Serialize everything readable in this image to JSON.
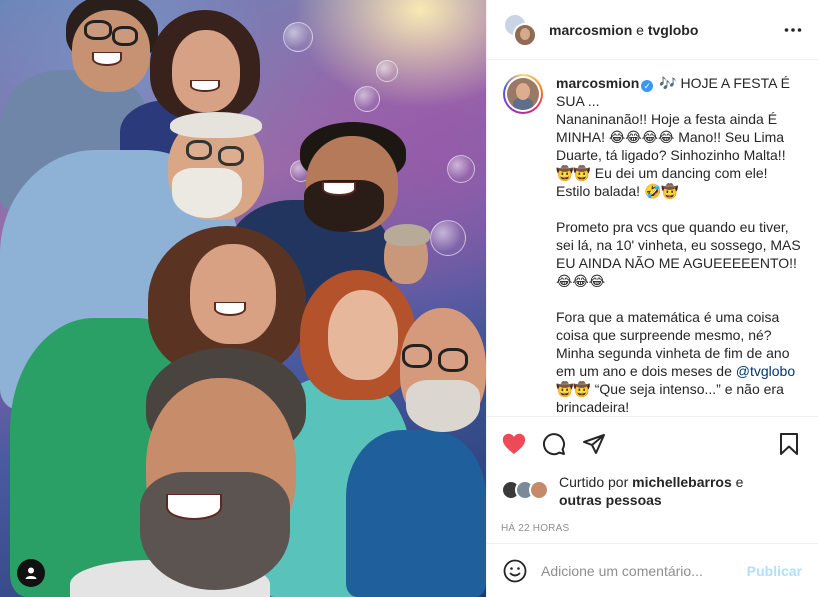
{
  "header": {
    "author": "marcosmion",
    "conjunction": "e",
    "collaborator": "tvglobo",
    "more_icon": "more-horizontal-icon"
  },
  "caption": {
    "username": "marcosmion",
    "verified_icon": "verified-badge-icon",
    "line1": " 🎶 HOJE A FESTA É SUA ...",
    "paragraph1": "Nananinanão!! Hoje a festa ainda É MINHA! 😂😂😂😂 Mano!! Seu Lima Duarte, tá ligado? Sinhozinho Malta!! 🤠🤠 Eu dei um dancing com ele! Estilo balada! 🤣🤠",
    "paragraph2": "Prometo pra vcs que quando eu tiver, sei lá, na 10' vinheta, eu sossego, MAS EU AINDA NÃO ME AGUEEEEENTO!! 😂😂😂",
    "paragraph3_a": "Fora que a matemática é uma coisa coisa que surpreende mesmo, né? Minha segunda vinheta de fim de ano em um ano e dois meses de ",
    "paragraph3_mention": "@tvglobo",
    "paragraph3_b": " 🤠🤠 “Que seja intenso...” e não era brincadeira!"
  },
  "actions": {
    "like_icon": "heart-filled-icon",
    "comment_icon": "comment-icon",
    "share_icon": "share-icon",
    "save_icon": "bookmark-icon",
    "like_color": "#ed4956"
  },
  "likes": {
    "prefix": "Curtido por ",
    "user": "michellebarros",
    "suffix": " e",
    "others": "outras pessoas"
  },
  "timestamp": "HÁ 22 HORAS",
  "comment_box": {
    "placeholder": "Adicione um comentário...",
    "post_label": "Publicar",
    "emoji_icon": "emoji-icon"
  },
  "photo": {
    "tag_icon": "user-tag-icon"
  }
}
